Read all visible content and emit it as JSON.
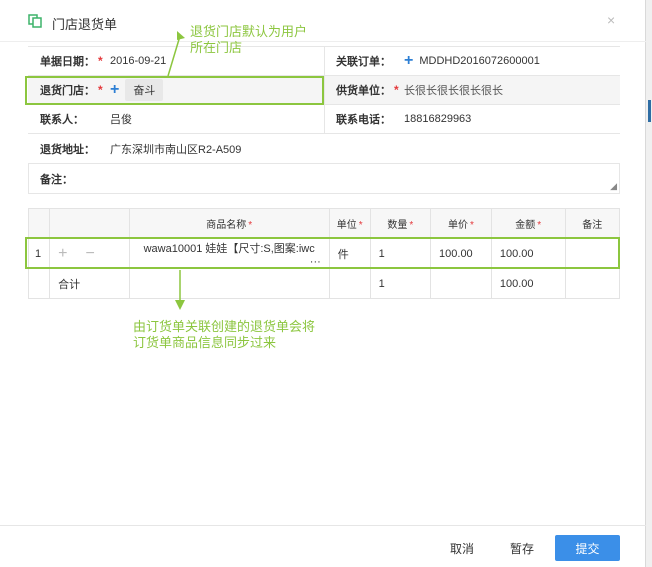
{
  "dialog": {
    "title": "门店退货单",
    "close": "×"
  },
  "form": {
    "date_label": "单据日期：",
    "date_value": "2016-09-21",
    "order_label": "关联订单：",
    "order_value": "MDDHD2016072600001",
    "store_label": "退货门店：",
    "store_value": "奋斗",
    "supplier_label": "供货单位：",
    "supplier_value": "长很长很长很长很长",
    "contact_label": "联系人：",
    "contact_value": "吕俊",
    "phone_label": "联系电话：",
    "phone_value": "18816829963",
    "address_label": "退货地址：",
    "address_value": "广东深圳市南山区R2-A509",
    "note_label": "备注：",
    "required_mark": "*"
  },
  "table": {
    "headers": [
      "商品名称",
      "单位",
      "数量",
      "单价",
      "金额",
      "备注"
    ],
    "row": {
      "index": "1",
      "product": "wawa10001 娃娃【尺寸:S,图案:iwc",
      "more": "···",
      "unit": "件",
      "qty": "1",
      "price": "100.00",
      "amount": "100.00",
      "note": ""
    },
    "total": {
      "label": "合计",
      "qty": "1",
      "amount": "100.00"
    }
  },
  "annotations": {
    "store_note_line1": "退货门店默认为用户",
    "store_note_line2": "所在门店",
    "row_note_line1": "由订货单关联创建的退货单会将",
    "row_note_line2": "订货单商品信息同步过来"
  },
  "footer": {
    "cancel": "取消",
    "draft": "暂存",
    "submit": "提交"
  },
  "colors": {
    "accent": "#3b8fe8",
    "annotation": "#8cc63f",
    "required": "#e4393c",
    "title_icon": "#3db36a"
  }
}
